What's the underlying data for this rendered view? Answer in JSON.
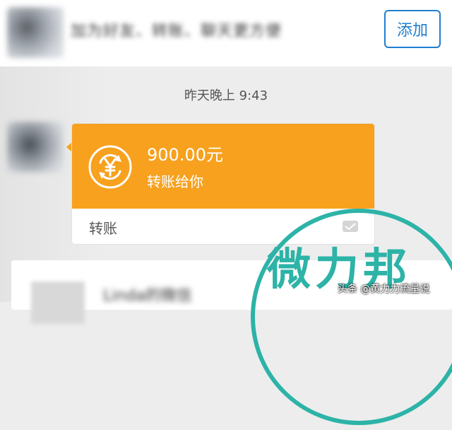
{
  "top_banner": {
    "blurred_text": "加为好友、转账、聊天更方便",
    "add_button_label": "添加"
  },
  "chat": {
    "timestamp": "昨天晚上 9:43",
    "transfer": {
      "amount": "900.00元",
      "description": "转账给你",
      "footer_label": "转账",
      "icon": "yuan-transfer-icon",
      "accent_color": "#f7a11e"
    }
  },
  "lower_card": {
    "blurred_text": "Linda的微信"
  },
  "watermark": {
    "brand": "微力邦",
    "credit": "头条 @黄力力流量说",
    "color": "#2db3a7"
  }
}
